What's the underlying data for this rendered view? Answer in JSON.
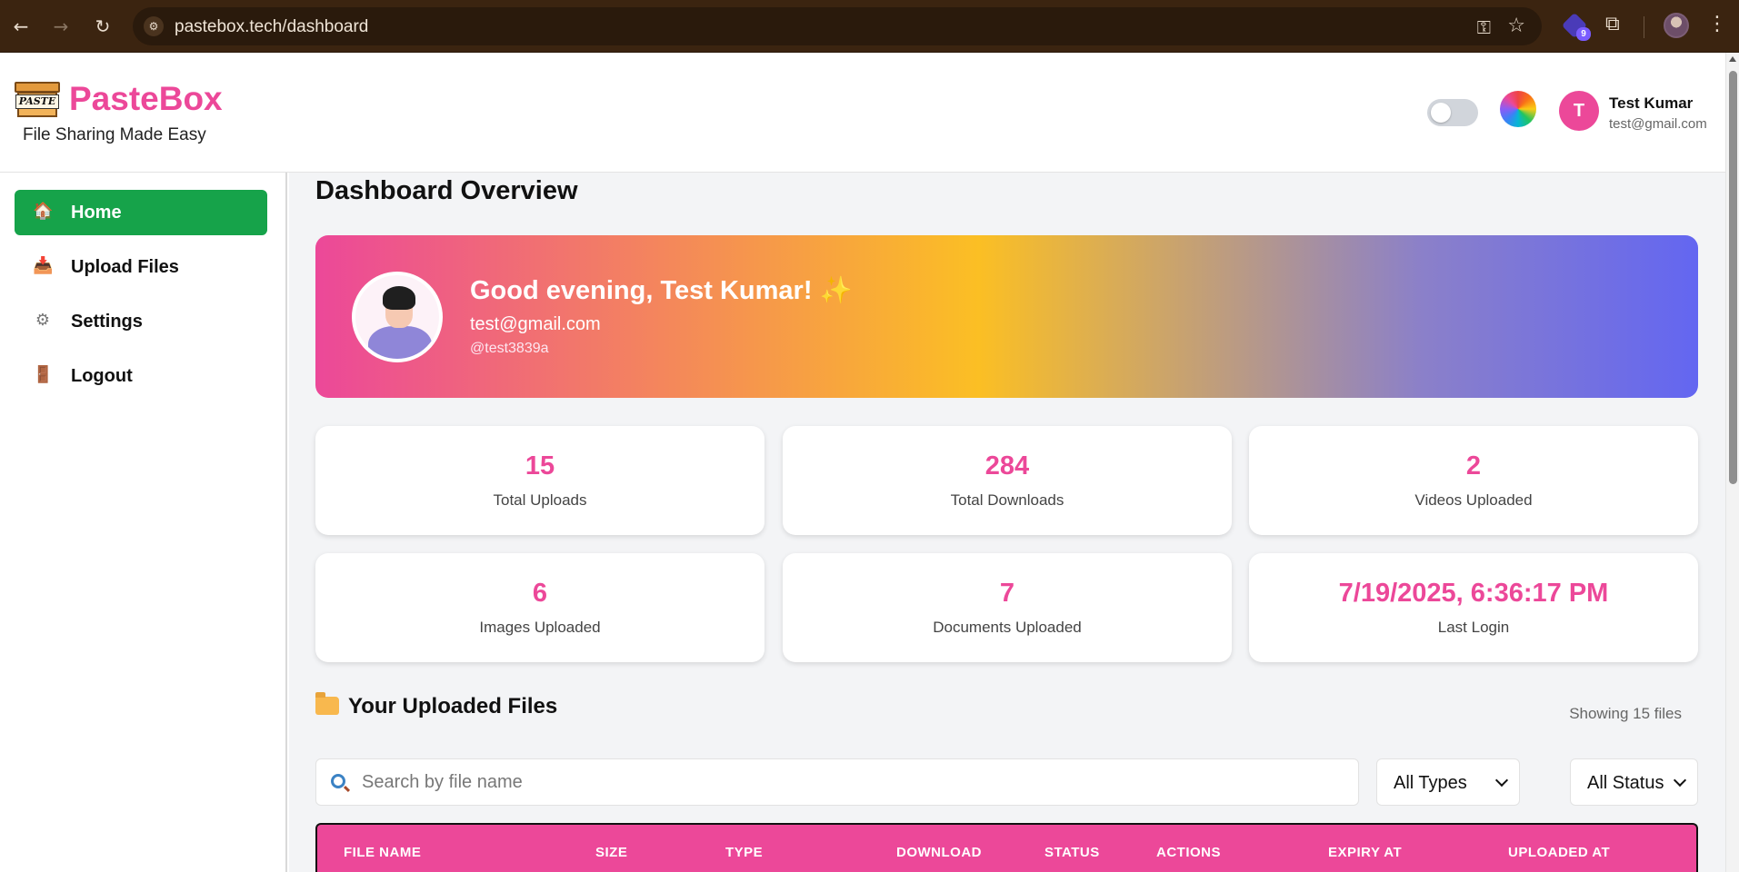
{
  "browser": {
    "url": "pastebox.tech/dashboard",
    "extension_badge": "9"
  },
  "header": {
    "brand_name": "PasteBox",
    "logo_text": "PASTE",
    "tagline": "File Sharing Made Easy",
    "user": {
      "initial": "T",
      "name": "Test Kumar",
      "email": "test@gmail.com"
    },
    "dark_mode_on": false
  },
  "sidebar": {
    "items": [
      {
        "label": "Home",
        "icon": "home-icon",
        "active": true
      },
      {
        "label": "Upload Files",
        "icon": "upload-icon",
        "active": false
      },
      {
        "label": "Settings",
        "icon": "gear-icon",
        "active": false
      },
      {
        "label": "Logout",
        "icon": "door-icon",
        "active": false
      }
    ]
  },
  "main": {
    "title": "Dashboard Overview",
    "banner": {
      "greeting": "Good evening, Test Kumar!",
      "sparkle": "✨",
      "email": "test@gmail.com",
      "handle": "@test3839a"
    },
    "stats": [
      {
        "value": "15",
        "label": "Total Uploads"
      },
      {
        "value": "284",
        "label": "Total Downloads"
      },
      {
        "value": "2",
        "label": "Videos Uploaded"
      },
      {
        "value": "6",
        "label": "Images Uploaded"
      },
      {
        "value": "7",
        "label": "Documents Uploaded"
      },
      {
        "value": "7/19/2025, 6:36:17 PM",
        "label": "Last Login"
      }
    ],
    "files": {
      "title": "Your Uploaded Files",
      "showing": "Showing 15 files",
      "search_placeholder": "Search by file name",
      "type_filter": "All Types",
      "status_filter": "All Status",
      "columns": [
        "FILE NAME",
        "SIZE",
        "TYPE",
        "DOWNLOAD",
        "STATUS",
        "ACTIONS",
        "EXPIRY AT",
        "UPLOADED AT"
      ]
    }
  },
  "colors": {
    "accent": "#ec4899",
    "active_nav": "#16a34a",
    "banner_start": "#ec4899",
    "banner_mid": "#fbbf24",
    "banner_end": "#6366f1"
  }
}
